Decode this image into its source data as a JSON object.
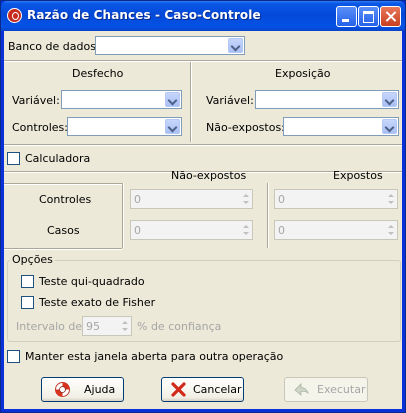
{
  "window": {
    "title": "Razão de Chances - Caso-Controle",
    "accent_color": "#0449d9",
    "controls": [
      "minimize-icon",
      "maximize-icon",
      "close-icon"
    ]
  },
  "database": {
    "label": "Banco de dados:",
    "value": ""
  },
  "outcome": {
    "heading": "Desfecho",
    "variable_label": "Variável:",
    "variable_value": "",
    "controls_label": "Controles:",
    "controls_value": ""
  },
  "exposure": {
    "heading": "Exposição",
    "variable_label": "Variável:",
    "variable_value": "",
    "unexposed_label": "Não-expostos:",
    "unexposed_value": ""
  },
  "calculator": {
    "checkbox_label": "Calculadora",
    "checked": false,
    "col_unexposed": "Não-expostos",
    "col_exposed": "Expostos",
    "row_controls": "Controles",
    "row_cases": "Casos",
    "values": {
      "controls_unexposed": "0",
      "controls_exposed": "0",
      "cases_unexposed": "0",
      "cases_exposed": "0"
    }
  },
  "options": {
    "group_title": "Opções",
    "chi_square_label": "Teste qui-quadrado",
    "fisher_label": "Teste exato de Fisher",
    "interval_prefix": "Intervalo de",
    "confidence_value": "95",
    "interval_suffix": "% de confiança"
  },
  "keep_open": {
    "label": "Manter esta janela aberta para outra operação",
    "checked": false
  },
  "buttons": {
    "help": "Ajuda",
    "cancel": "Cancelar",
    "execute": "Executar"
  },
  "icons": {
    "help": "lifebuoy-icon",
    "cancel": "red-x-icon",
    "execute": "run-arrow-icon"
  }
}
